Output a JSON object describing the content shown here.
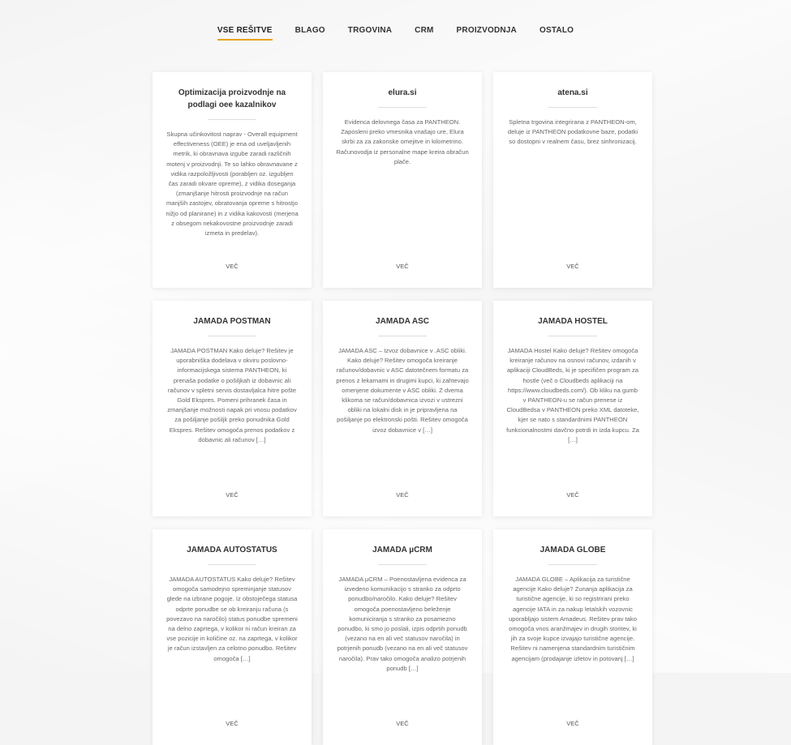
{
  "nav": {
    "items": [
      {
        "label": "VSE REŠITVE",
        "active": true
      },
      {
        "label": "BLAGO",
        "active": false
      },
      {
        "label": "TRGOVINA",
        "active": false
      },
      {
        "label": "CRM",
        "active": false
      },
      {
        "label": "PROIZVODNJA",
        "active": false
      },
      {
        "label": "OSTALO",
        "active": false
      }
    ],
    "accent_color": "#e8a31c"
  },
  "cards": [
    {
      "title": "Optimizacija proizvodnje na podlagi oee kazalnikov",
      "text": "Skupna učinkovitost naprav - Overall equipment effectiveness (OEE) je ena od uveljavljenih metrik, ki obravnava izgube zaradi različnih motenj v proizvodnji. Te so lahko obravnavane z vidika razpoložljivosti (porabljen oz. izgubljen čas zaradi okvare opreme), z vidika doseganja (zmanjšanje hitrosti proizvodnje na račun manjših zastojev, obratovanja opreme s hitrostjo nižjo od planirane) in z vidika kakovosti (merjena z obsegom nekakovostne proizvodnje zaradi izmeta in predelav).",
      "more": "VEČ"
    },
    {
      "title": "elura.si",
      "text": "Evidenca delovnega časa za PANTHEON. Zaposleni preko vmesnika vnašajo ure, Elura skrbi za za zakonske omejitve in kilometrino. Računovodja iz personalne mape kreira obračun plače.",
      "more": "VEČ"
    },
    {
      "title": "atena.si",
      "text": "Spletna trgovina integrirana z PANTHEON-om, deluje iz PANTHEON podatkovne baze, podatki so dostopni v realnem času, brez sinhronizacij.",
      "more": "VEČ"
    },
    {
      "title": "JAMADA POSTMAN",
      "text": "JAMADA POSTMAN Kako deluje? Rešitev je uporabniška dodelava v okviru poslovno-informacijskega sistema PANTHEON, ki prenaša podatke o pošiljkah iz dobavnic ali računov v spletni servis dostavljalca hitre pošte Gold Ekspres. Pomeni prihranek časa in zmanjšanje možnosti napak pri vnosu podatkov za pošiljanje pošiljk preko ponudnika Gold Ekspres. Rešitev omogoča prenos podatkov z dobavnic ali računov […]",
      "more": "VEČ"
    },
    {
      "title": "JAMADA ASC",
      "text": "JAMADA ASC – Izvoz dobavnice v .ASC obliki. Kako deluje? Rešitev omogoča kreiranje računov/dobavnic v ASC datotečnem formatu za prenos z lekarnami in drugimi kupci, ki zahtevajo omenjene dokumente v ASC obliki. Z dvema klikoma se račun/dobavnica izvozi v ustrezni obliki na lokalni disk in je pripravljena na pošiljanje po elektronski pošti. Rešitev omogoča izvoz dobavnice v […]",
      "more": "VEČ"
    },
    {
      "title": "JAMADA HOSTEL",
      "text": "JAMADA Hostel Kako deluje? Rešitev omogoča kreiranje računov na osnovi računov, izdanih v aplikaciji CloudBeds, ki je specifičen program za hostle (več o Cloudbeds aplikaciji na https://www.cloudbeds.com/). Ob kliku na gumb v PANTHEON-u se račun prenese iz CloudBedsa v PANTHEON preko XML datoteke, kjer se nato s standardnimi PANTHEON funkcionalnostmi davčno potrdi in izda kupcu. Za […]",
      "more": "VEČ"
    },
    {
      "title": "JAMADA AUTOSTATUS",
      "text": "JAMADA AUTOSTATUS Kako deluje? Rešitev omogoča samodejno spreminjanje statusov glede na izbrane pogoje. Iz obstoječega statusa odprte ponudbe se ob kreiranju računa (s povezavo na naročilo) status ponudbe spremeni na delno zaprtega, v kolikor ni račun kreiran za vse pozicije in količine oz. na zaprtega, v kolikor je račun izstavljen za celotno ponudbo. Rešitev omogoča […]",
      "more": "VEČ"
    },
    {
      "title": "JAMADA µCRM",
      "text": "JAMADA µCRM – Poenostavljena evidenca za izvedeno komunikacijo s stranko za odprto ponudbo/naročilo. Kako deluje? Rešitev omogoča poenostavljeno beleženje komuniciranja s stranko za posamezno ponudbo, ki smo jo poslali, izpis odprtih ponudb (vezano na en ali več statusov naročila) in potrjenih ponudb (vezano na en ali več statusov naročila). Prav tako omogoča analizo potrjenih ponudb […]",
      "more": "VEČ"
    },
    {
      "title": "JAMADA GLOBE",
      "text": "JAMADA GLOBE – Aplikacija za turistične agencije Kako deluje? Zunanja aplikacija za turistične agencije, ki so registrirani preko agencije IATA in za nakup letalskih vozovnic uporabljajo sistem Amadeus. Rešitev prav tako omogoča vnos aranžmajev in drugih storitev, ki jih za svoje kupce izvajajo turistične agencije. Rešitev ni namenjena standardnim turističnim agencijam (prodajanje izletov in potovanj […]",
      "more": "VEČ"
    }
  ]
}
